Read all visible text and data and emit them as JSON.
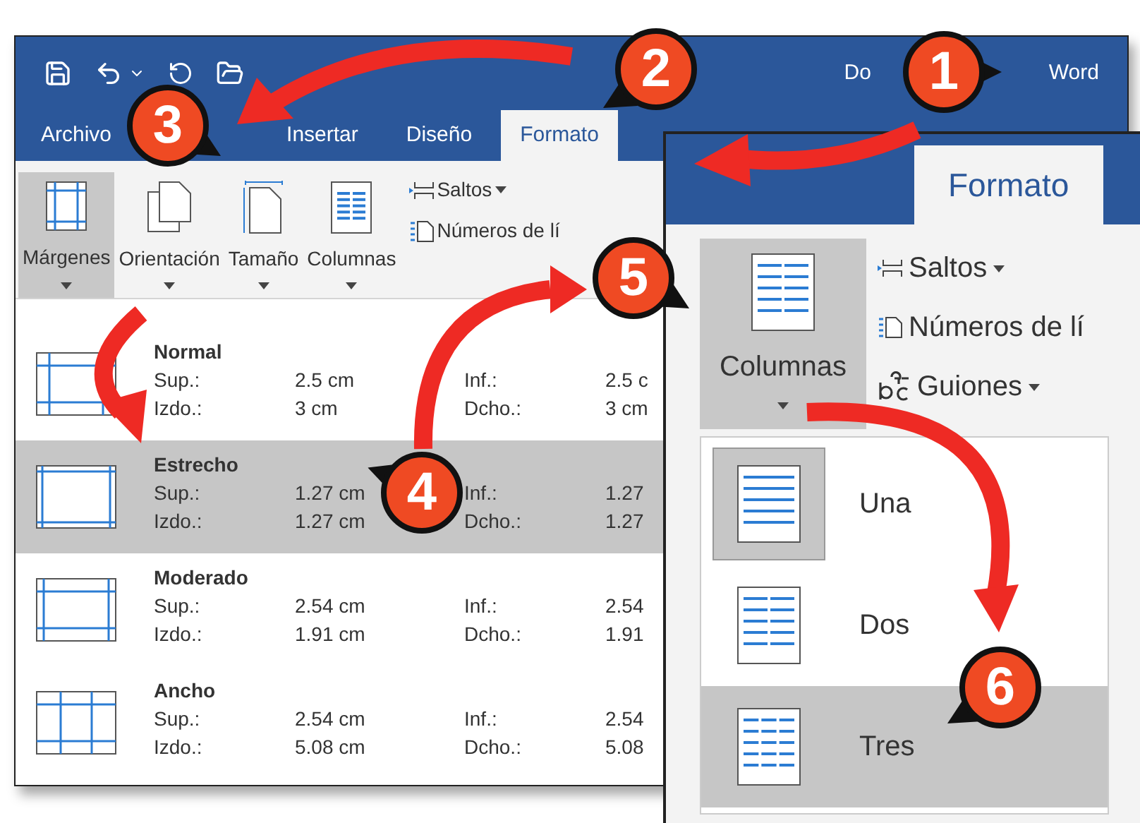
{
  "window": {
    "title_start": "Do",
    "title_end": "Word"
  },
  "tabs": [
    {
      "label": "Archivo",
      "selected": false
    },
    {
      "label": "Insertar",
      "selected": false
    },
    {
      "label": "Diseño",
      "selected": false
    },
    {
      "label": "Formato",
      "selected": true
    }
  ],
  "ribbon": {
    "large_buttons": [
      {
        "label": "Márgenes",
        "kind": "margins",
        "selected": true
      },
      {
        "label": "Orientación",
        "kind": "orientation",
        "selected": false
      },
      {
        "label": "Tamaño",
        "kind": "size",
        "selected": false
      },
      {
        "label": "Columnas",
        "kind": "columns",
        "selected": false
      }
    ],
    "small_buttons": [
      {
        "label": "Saltos",
        "kind": "breaks"
      },
      {
        "label": "Números de lí",
        "kind": "line-numbers"
      }
    ]
  },
  "margins": [
    {
      "name": "Normal",
      "kind": "normal",
      "selected": false,
      "lines": [
        [
          "Sup.:",
          "2.5 cm",
          "Inf.:",
          "2.5 c"
        ],
        [
          "Izdo.:",
          "3 cm",
          "Dcho.:",
          "3 cm"
        ]
      ]
    },
    {
      "name": "Estrecho",
      "kind": "narrow",
      "selected": true,
      "lines": [
        [
          "Sup.:",
          "1.27 cm",
          "Inf.:",
          "1.27"
        ],
        [
          "Izdo.:",
          "1.27 cm",
          "Dcho.:",
          "1.27"
        ]
      ]
    },
    {
      "name": "Moderado",
      "kind": "moderate",
      "selected": false,
      "lines": [
        [
          "Sup.:",
          "2.54 cm",
          "Inf.:",
          "2.54"
        ],
        [
          "Izdo.:",
          "1.91 cm",
          "Dcho.:",
          "1.91"
        ]
      ]
    },
    {
      "name": "Ancho",
      "kind": "wide",
      "selected": false,
      "lines": [
        [
          "Sup.:",
          "2.54 cm",
          "Inf.:",
          "2.54"
        ],
        [
          "Izdo.:",
          "5.08 cm",
          "Dcho.:",
          "5.08"
        ]
      ]
    }
  ],
  "zoomed": {
    "tab": {
      "label": "Formato",
      "selected": true
    },
    "large_button": {
      "label": "Columnas",
      "selected": true
    },
    "small_buttons": [
      {
        "label": "Saltos",
        "kind": "breaks"
      },
      {
        "label": "Números de lí",
        "kind": "line-numbers"
      },
      {
        "label": "Guiones",
        "kind": "hyphenation"
      }
    ],
    "columns_menu": [
      {
        "label": "Una",
        "kind": "one",
        "current": true,
        "selected": false
      },
      {
        "label": "Dos",
        "kind": "two",
        "current": false,
        "selected": false
      },
      {
        "label": "Tres",
        "kind": "three",
        "current": false,
        "selected": true
      }
    ]
  },
  "callouts": [
    {
      "number": "1"
    },
    {
      "number": "2"
    },
    {
      "number": "3"
    },
    {
      "number": "4"
    },
    {
      "number": "5"
    },
    {
      "number": "6"
    }
  ]
}
